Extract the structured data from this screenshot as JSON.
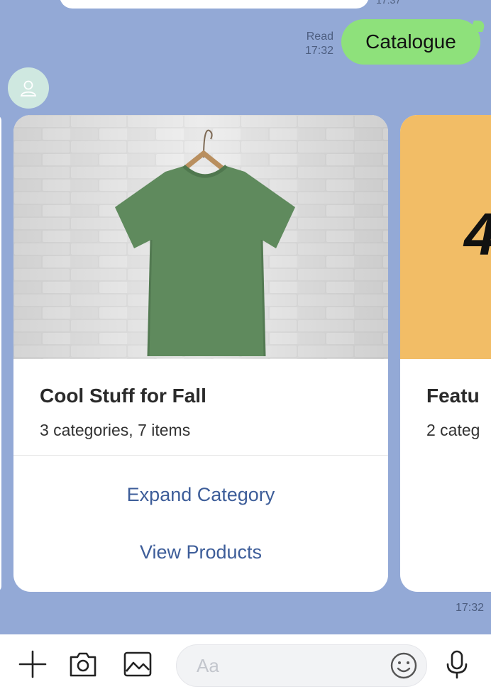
{
  "chat": {
    "prev_time": "17:37",
    "read_label": "Read",
    "read_time": "17:32",
    "sent_message": "Catalogue",
    "message_time": "17:32"
  },
  "cards": [
    {
      "title": "Cool Stuff for Fall",
      "subtitle": "3 categories, 7 items",
      "actions": [
        "Expand Category",
        "View Products"
      ]
    },
    {
      "title": "Featu",
      "subtitle": "2 categ",
      "image_text": "4"
    }
  ],
  "input": {
    "placeholder": "Aa"
  },
  "icons": {
    "plus": "plus-icon",
    "camera": "camera-icon",
    "gallery": "image-icon",
    "emoji": "emoji-icon",
    "mic": "microphone-icon",
    "avatar": "user-icon"
  },
  "colors": {
    "background": "#93a9d6",
    "sent_bubble": "#8ee17b",
    "action_link": "#3d5d99",
    "card2_image": "#f2bd66",
    "shirt": "#5f8a5d"
  }
}
